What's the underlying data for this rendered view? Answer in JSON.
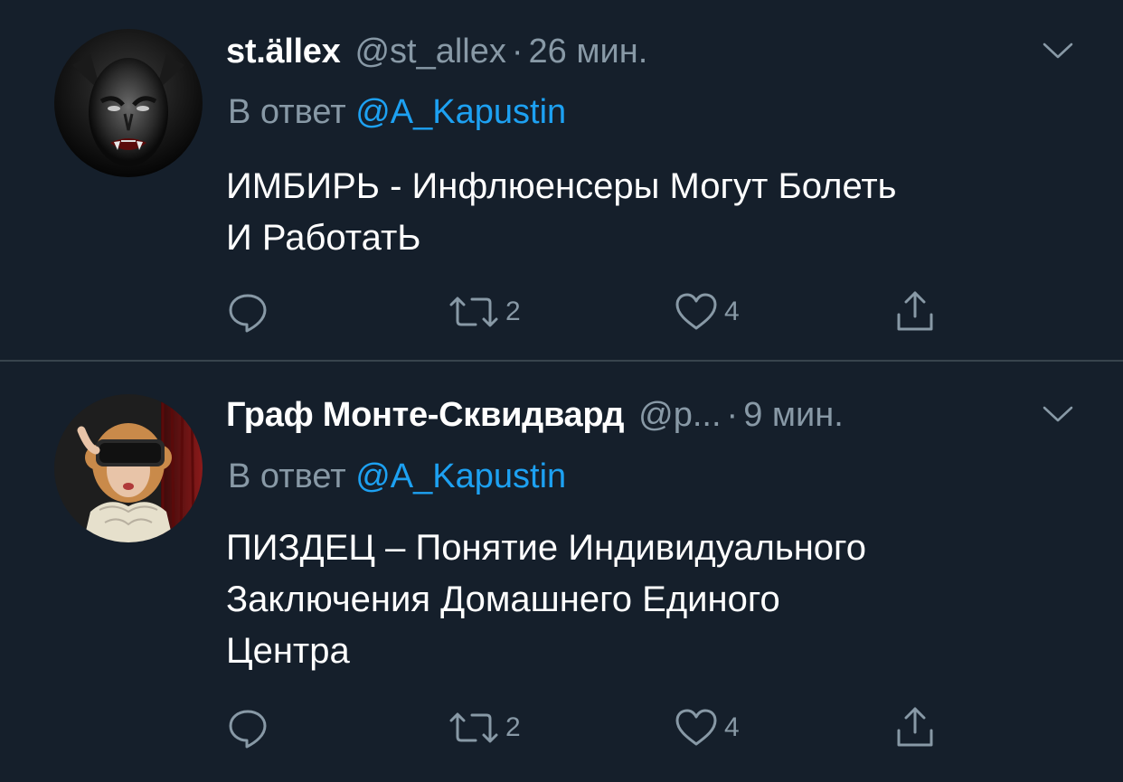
{
  "tweets": [
    {
      "display_name": "st.ällex",
      "handle": "@st_allex",
      "separator": "·",
      "time": "26 мин.",
      "reply_prefix": "В ответ",
      "reply_to": "@A_Kapustin",
      "body_lines": [
        "ИМБИРЬ - Инфлюенсеры Могут Болеть",
        "И РаботатЬ"
      ],
      "retweets": "2",
      "likes": "4",
      "avatar": "vampire-face"
    },
    {
      "display_name": "Граф Монте-Сквидвард",
      "handle": "@р...",
      "separator": "·",
      "time": "9 мин.",
      "reply_prefix": "В ответ",
      "reply_to": "@A_Kapustin",
      "body_lines": [
        "ПИЗДЕЦ – Понятие Индивидуального",
        "Заключения Домашнего Единого",
        "Центра"
      ],
      "retweets": "2",
      "likes": "4",
      "avatar": "vr-headset-portrait"
    }
  ],
  "colors": {
    "background": "#151f2b",
    "divider": "#38444d",
    "secondary_text": "#8899a6",
    "accent": "#1da1f2",
    "primary_text": "#ffffff"
  },
  "icons": {
    "menu": "chevron-down-icon",
    "reply": "reply-icon",
    "retweet": "retweet-icon",
    "like": "heart-icon",
    "share": "share-icon"
  }
}
